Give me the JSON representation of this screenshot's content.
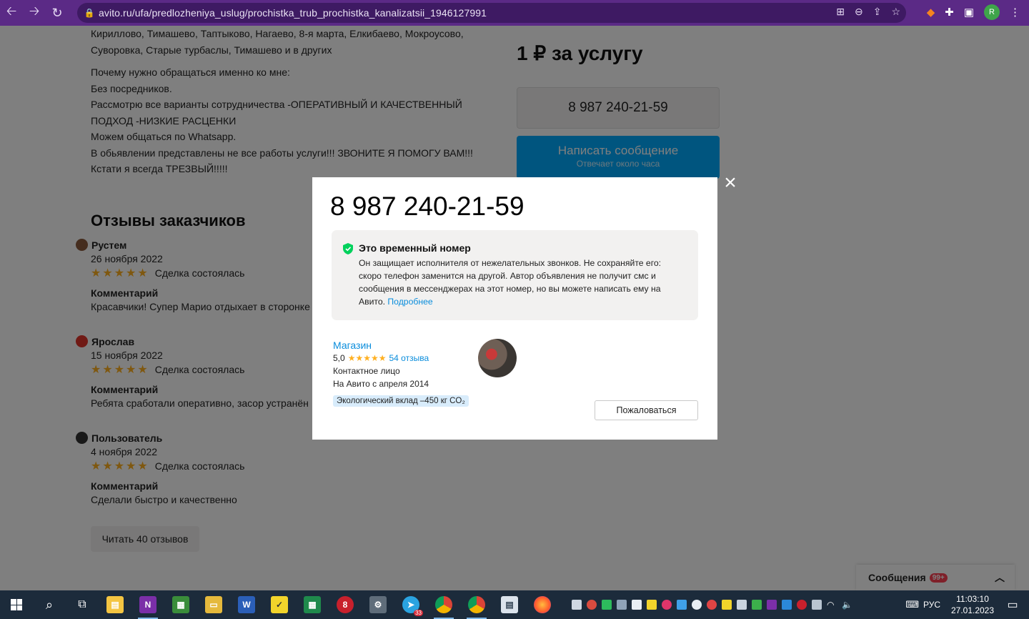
{
  "browser": {
    "url": "avito.ru/ufa/predlozheniya_uslug/prochistka_trub_prochistka_kanalizatsii_1946127991",
    "profile_initial": "R"
  },
  "page": {
    "description_lines": [
      "Кириллово, Тимашево, Таптыково, Нагаево, 8-я марта, Елкибаево, Мокроусово,",
      "Суворовка, Старые турбаслы, Тимашево и в других"
    ],
    "why_lines": [
      "Почему нужно обращаться именно ко мне:",
      "Без посредников.",
      "Рассмотрю все варианты сотрудничества -ОПЕРАТИВНЫЙ И КАЧЕСТВЕННЫЙ",
      "ПОДХОД -НИЗКИЕ РАСЦЕНКИ",
      "Можем общаться по Whatsapp.",
      "В обьявлении представлены не все работы услуги!!! ЗВОНИТЕ Я ПОМОГУ ВАМ!!!",
      "Кстати я всегда ТРЕЗВЫЙ!!!!!"
    ],
    "price": "1 ₽ за услугу",
    "phone_button": "8 987 240-21-59",
    "message_button": "Написать сообщение",
    "message_sub": "Отвечает около часа",
    "reviews_title": "Отзывы заказчиков",
    "reviews": [
      {
        "name": "Рустем",
        "date": "26 ноября 2022",
        "stars": "★★★★★",
        "deal": "Сделка состоялась",
        "comment_label": "Комментарий",
        "comment": "Красавчики! Супер Марио отдыхает в сторонке"
      },
      {
        "name": "Ярослав",
        "date": "15 ноября 2022",
        "stars": "★★★★★",
        "deal": "Сделка состоялась",
        "comment_label": "Комментарий",
        "comment": "Ребята сработали оперативно, засор устранён"
      },
      {
        "name": "Пользователь",
        "date": "4 ноября 2022",
        "stars": "★★★★★",
        "deal": "Сделка состоялась",
        "comment_label": "Комментарий",
        "comment": "Сделали быстро и качественно"
      }
    ],
    "read_more": "Читать 40 отзывов",
    "messages_label": "Сообщения",
    "messages_badge": "99+"
  },
  "modal": {
    "close": "×",
    "phone": "8 987 240-21-59",
    "temp_title": "Это временный номер",
    "temp_text": "Он защищает исполнителя от нежелательных звонков. Не сохраняйте его: скоро телефон заменится на другой. Автор объявления не получит смс и сообщения в мессенджерах на этот номер, но вы можете написать ему на Авито.",
    "more_link": "Подробнее",
    "seller_name": "Магазин",
    "rating": "5,0",
    "rating_stars": "★★★★★",
    "reviews_link": "54 отзыва",
    "contact": "Контактное лицо",
    "since": "На Авито с апреля 2014",
    "eco": "Экологический вклад –450 кг CO₂",
    "report": "Пожаловаться"
  },
  "taskbar": {
    "language": "РУС",
    "time": "11:03:10",
    "date": "27.01.2023",
    "telegram_badge": "33"
  }
}
